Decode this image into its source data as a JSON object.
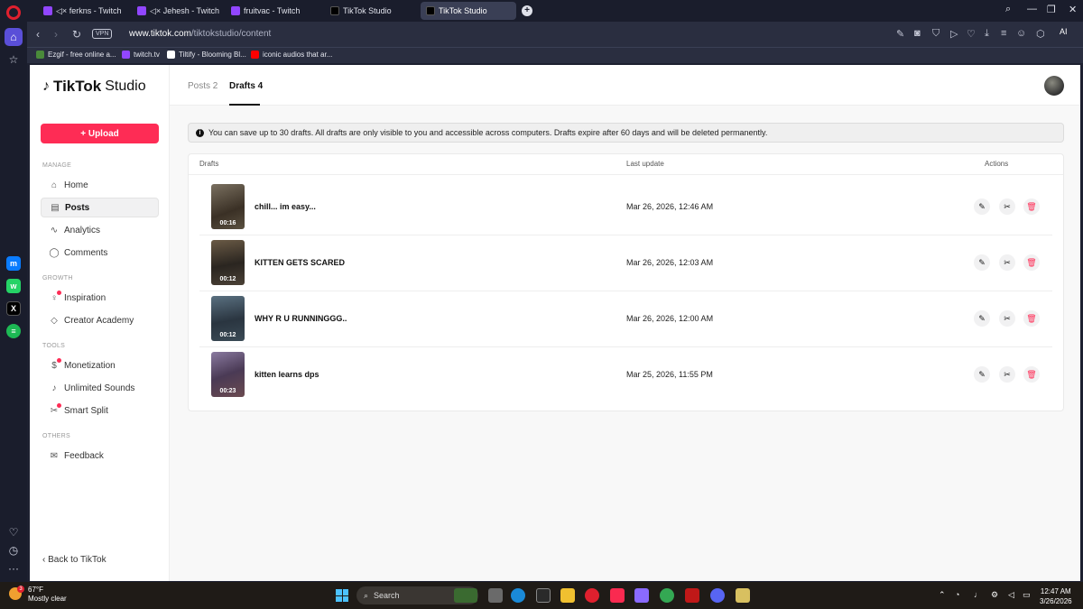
{
  "browser": {
    "tabs": [
      {
        "label": "ferkns - Twitch",
        "muted": true,
        "favicon": "twitch-icon"
      },
      {
        "label": "Jehesh - Twitch",
        "muted": true,
        "favicon": "twitch-icon"
      },
      {
        "label": "fruitvac - Twitch",
        "muted": false,
        "favicon": "twitch-icon"
      },
      {
        "label": "TikTok Studio",
        "muted": false,
        "favicon": "tiktok-icon"
      },
      {
        "label": "TikTok Studio",
        "muted": false,
        "favicon": "tiktok-icon",
        "active": true
      }
    ],
    "vpn_label": "VPN",
    "url_domain": "www.tiktok.com",
    "url_path": "/tiktokstudio/content",
    "ai_label": "AI",
    "bookmarks": [
      {
        "label": "Ezgif - free online a...",
        "color": "#4a8a3a"
      },
      {
        "label": "twitch.tv",
        "color": "#9146ff"
      },
      {
        "label": "Tiltify - Blooming Bl...",
        "color": "#ffffff"
      },
      {
        "label": "iconic audios that ar...",
        "color": "#ff0000"
      }
    ]
  },
  "sidebar": {
    "logo_text": "TikTok",
    "logo_sub": "Studio",
    "upload_label": "+ Upload",
    "sections": {
      "manage": "MANAGE",
      "growth": "GROWTH",
      "tools": "TOOLS",
      "others": "OTHERS"
    },
    "items": {
      "home": "Home",
      "posts": "Posts",
      "analytics": "Analytics",
      "comments": "Comments",
      "inspiration": "Inspiration",
      "creator_academy": "Creator Academy",
      "monetization": "Monetization",
      "unlimited_sounds": "Unlimited Sounds",
      "smart_split": "Smart Split",
      "feedback": "Feedback"
    },
    "back_label": "Back to TikTok"
  },
  "main": {
    "tabs": {
      "posts": "Posts 2",
      "drafts": "Drafts 4"
    },
    "notice": "You can save up to 30 drafts. All drafts are only visible to you and accessible across computers. Drafts expire after 60 days and will be deleted permanently.",
    "columns": {
      "drafts": "Drafts",
      "last_update": "Last update",
      "actions": "Actions"
    },
    "drafts": [
      {
        "title": "chill... im easy...",
        "duration": "00:16",
        "date": "Mar 26, 2026, 12:46 AM",
        "thumb": "#5a5040"
      },
      {
        "title": "KITTEN GETS SCARED",
        "duration": "00:12",
        "date": "Mar 26, 2026, 12:03 AM",
        "thumb": "#4a4035"
      },
      {
        "title": "WHY R U RUNNINGGG..",
        "duration": "00:12",
        "date": "Mar 26, 2026, 12:00 AM",
        "thumb": "#3a4a55"
      },
      {
        "title": "kitten learns dps",
        "duration": "00:23",
        "date": "Mar 25, 2026, 11:55 PM",
        "thumb": "#5a4a6a"
      }
    ]
  },
  "taskbar": {
    "weather_badge": "3",
    "temp": "67°F",
    "condition": "Mostly clear",
    "search_label": "Search",
    "time": "12:47 AM",
    "date": "3/26/2026"
  },
  "colors": {
    "accent": "#fe2c55",
    "opera_active": "#5a4fd8"
  }
}
